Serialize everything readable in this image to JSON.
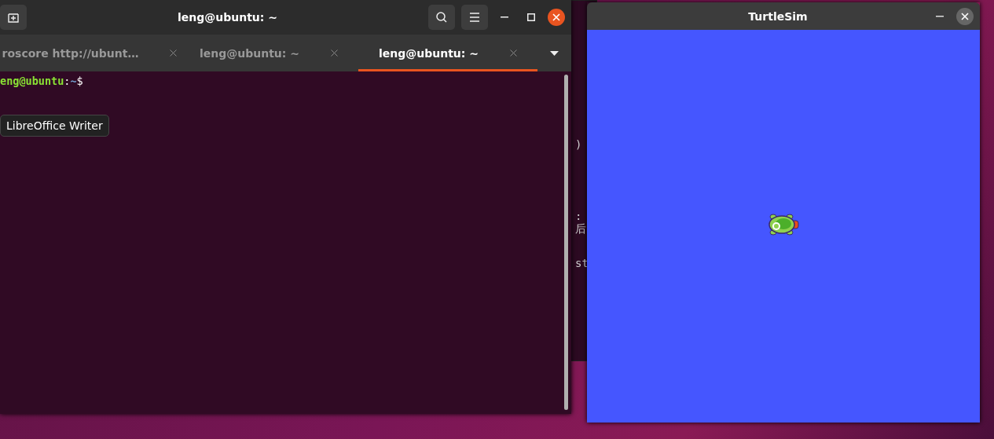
{
  "terminal": {
    "title": "leng@ubuntu: ~",
    "tabs": [
      {
        "label": "roscore http://ubunt…",
        "selected": false
      },
      {
        "label": "leng@ubuntu: ~",
        "selected": false
      },
      {
        "label": "leng@ubuntu: ~",
        "selected": true
      }
    ],
    "prompt": {
      "user_host": "eng@ubuntu",
      "separator": ":",
      "path": "~",
      "symbol": "$"
    }
  },
  "tooltip": {
    "text": "LibreOffice Writer"
  },
  "background_window": {
    "fragments": [
      ")",
      ":",
      "后",
      "st"
    ]
  },
  "turtlesim": {
    "title": "TurtleSim"
  }
}
